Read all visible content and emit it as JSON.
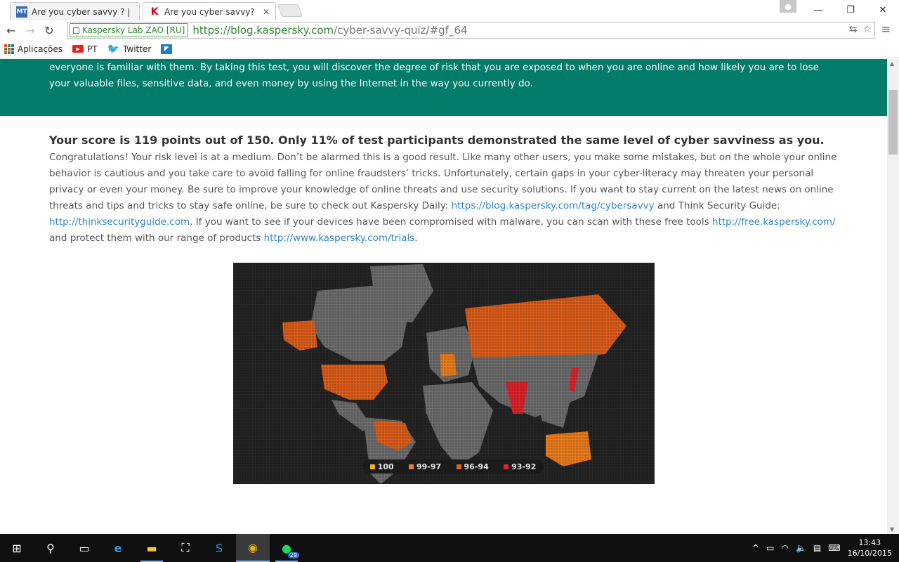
{
  "tabs": [
    {
      "title": "Are you cyber savvy ? | Pa",
      "favicon": "MT",
      "active": false
    },
    {
      "title": "Are you cyber savvy? | Kas",
      "favicon": "K",
      "active": true
    }
  ],
  "toolbar": {
    "ev_label": "Kaspersky Lab ZAO [RU]",
    "url_host": "https://blog.kaspersky.com",
    "url_path": "/cyber-savvy-quiz/#gf_64"
  },
  "bookmarks": [
    {
      "label": "Aplicações",
      "icon": "apps-icon"
    },
    {
      "label": "PT",
      "icon": "youtube-icon"
    },
    {
      "label": "Twitter",
      "icon": "twitter-icon"
    },
    {
      "label": "",
      "icon": "bookmark-app-icon"
    }
  ],
  "banner": {
    "text": "everyone is familiar with them. By taking this test, you will discover the degree of risk that you are exposed to when you are online and how likely you are to lose your valuable files, sensitive data, and even money by using the Internet in the way you currently do."
  },
  "result": {
    "lead": "Your score is 119 points out of 150. Only 11% of test participants demonstrated the same level of cyber savviness as you.",
    "p1": "Congratulations! Your risk level is at a medium. Don’t be alarmed this is a good result. Like many other users, you make some mistakes, but on the whole your online behavior is cautious and you take care to avoid falling for online fraudsters’ tricks. Unfortunately, certain gaps in your cyber-literacy may threaten your personal privacy or even your money. Be sure to improve your knowledge of online threats and use security solutions. If you want to stay current on the latest news on online threats and tips and tricks to stay safe online, be sure to check out Kaspersky Daily:",
    "link1": "https://blog.kaspersky.com/tag/cybersavvy",
    "p2": "and Think Security Guide:",
    "link2": "http://thinksecurityguide.com",
    "p3": ". If you want to see if your devices have been compromised with malware, you can scan with these free tools",
    "link3": "http://free.kaspersky.com/",
    "p4": "and protect them with our range of products",
    "link4": "http://www.kaspersky.com/trials",
    "p5": "."
  },
  "map_legend": [
    {
      "label": "100",
      "color": "#f2b01e"
    },
    {
      "label": "99-97",
      "color": "#f07f1d"
    },
    {
      "label": "96-94",
      "color": "#e0601c"
    },
    {
      "label": "93-92",
      "color": "#e0242a"
    }
  ],
  "map_colors": {
    "land": "#6f6f6f",
    "background": "#262626"
  },
  "taskbar": {
    "time": "13:43",
    "date": "16/10/2015",
    "spotify_badge": "29"
  }
}
